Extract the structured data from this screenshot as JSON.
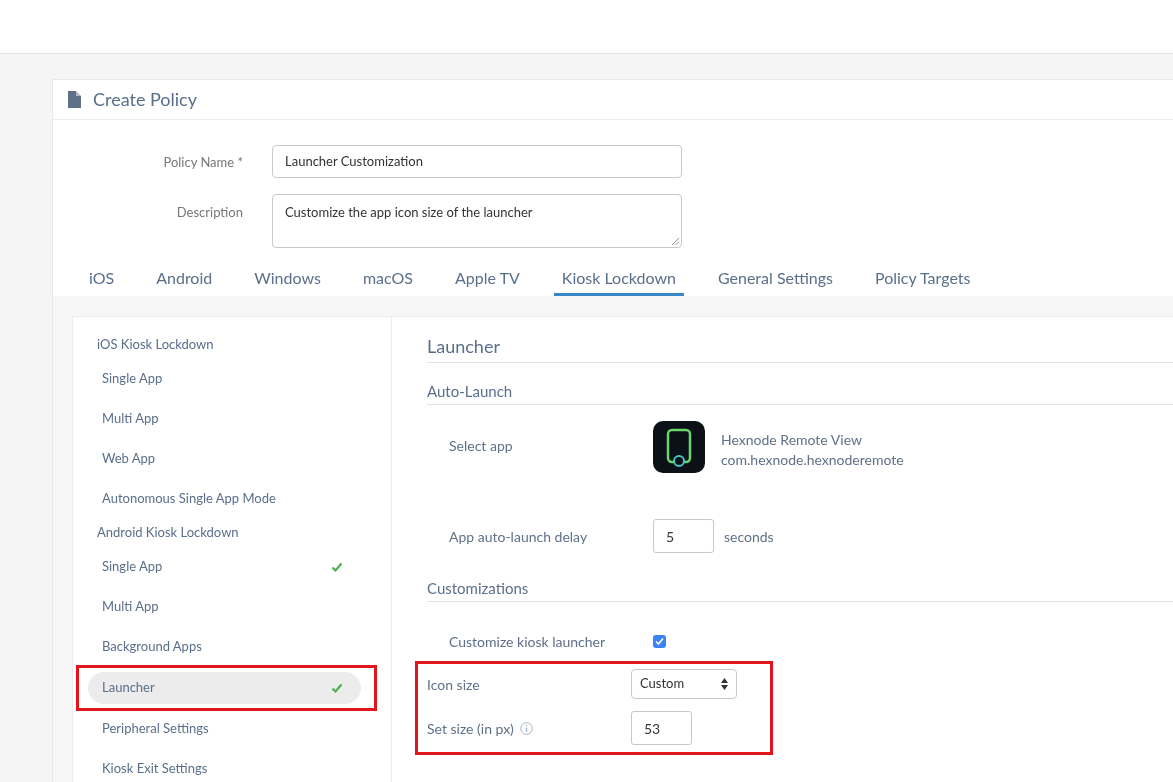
{
  "page": {
    "title": "Create Policy"
  },
  "form": [
    {
      "label": "Policy Name *",
      "kind": "input",
      "value": "Launcher Customization"
    },
    {
      "label": "Description",
      "kind": "textarea",
      "value": "Customize the app icon size of the launcher"
    }
  ],
  "tabs": [
    {
      "label": "iOS",
      "selected": false
    },
    {
      "label": "Android",
      "selected": false
    },
    {
      "label": "Windows",
      "selected": false
    },
    {
      "label": "macOS",
      "selected": false
    },
    {
      "label": "Apple TV",
      "selected": false
    },
    {
      "label": "Kiosk Lockdown",
      "selected": true
    },
    {
      "label": "General Settings",
      "selected": false
    },
    {
      "label": "Policy Targets",
      "selected": false
    }
  ],
  "sidebar": {
    "items": [
      {
        "kind": "heading",
        "label": "iOS Kiosk Lockdown"
      },
      {
        "kind": "item",
        "label": "Single App",
        "checked": false,
        "selected": false,
        "highlighted": false
      },
      {
        "kind": "item",
        "label": "Multi App",
        "checked": false,
        "selected": false,
        "highlighted": false
      },
      {
        "kind": "item",
        "label": "Web App",
        "checked": false,
        "selected": false,
        "highlighted": false
      },
      {
        "kind": "item",
        "label": "Autonomous Single App Mode",
        "checked": false,
        "selected": false,
        "highlighted": false
      },
      {
        "kind": "heading",
        "label": "Android Kiosk Lockdown"
      },
      {
        "kind": "item",
        "label": "Single App",
        "checked": true,
        "selected": false,
        "highlighted": false
      },
      {
        "kind": "item",
        "label": "Multi App",
        "checked": false,
        "selected": false,
        "highlighted": false
      },
      {
        "kind": "item",
        "label": "Background Apps",
        "checked": false,
        "selected": false,
        "highlighted": false
      },
      {
        "kind": "item",
        "label": "Launcher",
        "checked": true,
        "selected": true,
        "highlighted": true
      },
      {
        "kind": "item",
        "label": "Peripheral Settings",
        "checked": false,
        "selected": false,
        "highlighted": false
      },
      {
        "kind": "item",
        "label": "Kiosk Exit Settings",
        "checked": false,
        "selected": false,
        "highlighted": false
      }
    ]
  },
  "content": {
    "title": "Launcher",
    "sections": [
      {
        "title": "Auto-Launch",
        "rows": [
          {
            "kind": "app",
            "label": "Select app",
            "app_name": "Hexnode Remote View",
            "app_id": "com.hexnode.hexnoderemote",
            "highlighted": false
          },
          {
            "kind": "number",
            "label": "App auto-launch delay",
            "value": "5",
            "suffix": "seconds",
            "highlighted": false
          }
        ]
      },
      {
        "title": "Customizations",
        "rows": [
          {
            "kind": "checkbox",
            "label": "Customize kiosk launcher",
            "checked": true,
            "highlighted": false
          },
          {
            "kind": "select",
            "label": "Icon size",
            "value": "Custom",
            "highlighted": true
          },
          {
            "kind": "number",
            "label": "Set size (in px)",
            "value": "53",
            "info": true,
            "highlighted": true
          }
        ]
      }
    ]
  }
}
